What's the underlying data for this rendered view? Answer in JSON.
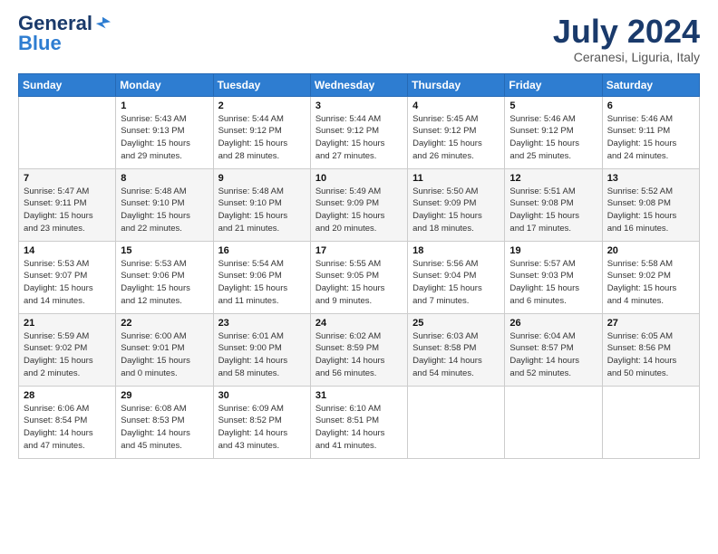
{
  "logo": {
    "general": "General",
    "blue": "Blue"
  },
  "title": "July 2024",
  "location": "Ceranesi, Liguria, Italy",
  "weekdays": [
    "Sunday",
    "Monday",
    "Tuesday",
    "Wednesday",
    "Thursday",
    "Friday",
    "Saturday"
  ],
  "weeks": [
    [
      {
        "day": "",
        "info": ""
      },
      {
        "day": "1",
        "info": "Sunrise: 5:43 AM\nSunset: 9:13 PM\nDaylight: 15 hours\nand 29 minutes."
      },
      {
        "day": "2",
        "info": "Sunrise: 5:44 AM\nSunset: 9:12 PM\nDaylight: 15 hours\nand 28 minutes."
      },
      {
        "day": "3",
        "info": "Sunrise: 5:44 AM\nSunset: 9:12 PM\nDaylight: 15 hours\nand 27 minutes."
      },
      {
        "day": "4",
        "info": "Sunrise: 5:45 AM\nSunset: 9:12 PM\nDaylight: 15 hours\nand 26 minutes."
      },
      {
        "day": "5",
        "info": "Sunrise: 5:46 AM\nSunset: 9:12 PM\nDaylight: 15 hours\nand 25 minutes."
      },
      {
        "day": "6",
        "info": "Sunrise: 5:46 AM\nSunset: 9:11 PM\nDaylight: 15 hours\nand 24 minutes."
      }
    ],
    [
      {
        "day": "7",
        "info": "Sunrise: 5:47 AM\nSunset: 9:11 PM\nDaylight: 15 hours\nand 23 minutes."
      },
      {
        "day": "8",
        "info": "Sunrise: 5:48 AM\nSunset: 9:10 PM\nDaylight: 15 hours\nand 22 minutes."
      },
      {
        "day": "9",
        "info": "Sunrise: 5:48 AM\nSunset: 9:10 PM\nDaylight: 15 hours\nand 21 minutes."
      },
      {
        "day": "10",
        "info": "Sunrise: 5:49 AM\nSunset: 9:09 PM\nDaylight: 15 hours\nand 20 minutes."
      },
      {
        "day": "11",
        "info": "Sunrise: 5:50 AM\nSunset: 9:09 PM\nDaylight: 15 hours\nand 18 minutes."
      },
      {
        "day": "12",
        "info": "Sunrise: 5:51 AM\nSunset: 9:08 PM\nDaylight: 15 hours\nand 17 minutes."
      },
      {
        "day": "13",
        "info": "Sunrise: 5:52 AM\nSunset: 9:08 PM\nDaylight: 15 hours\nand 16 minutes."
      }
    ],
    [
      {
        "day": "14",
        "info": "Sunrise: 5:53 AM\nSunset: 9:07 PM\nDaylight: 15 hours\nand 14 minutes."
      },
      {
        "day": "15",
        "info": "Sunrise: 5:53 AM\nSunset: 9:06 PM\nDaylight: 15 hours\nand 12 minutes."
      },
      {
        "day": "16",
        "info": "Sunrise: 5:54 AM\nSunset: 9:06 PM\nDaylight: 15 hours\nand 11 minutes."
      },
      {
        "day": "17",
        "info": "Sunrise: 5:55 AM\nSunset: 9:05 PM\nDaylight: 15 hours\nand 9 minutes."
      },
      {
        "day": "18",
        "info": "Sunrise: 5:56 AM\nSunset: 9:04 PM\nDaylight: 15 hours\nand 7 minutes."
      },
      {
        "day": "19",
        "info": "Sunrise: 5:57 AM\nSunset: 9:03 PM\nDaylight: 15 hours\nand 6 minutes."
      },
      {
        "day": "20",
        "info": "Sunrise: 5:58 AM\nSunset: 9:02 PM\nDaylight: 15 hours\nand 4 minutes."
      }
    ],
    [
      {
        "day": "21",
        "info": "Sunrise: 5:59 AM\nSunset: 9:02 PM\nDaylight: 15 hours\nand 2 minutes."
      },
      {
        "day": "22",
        "info": "Sunrise: 6:00 AM\nSunset: 9:01 PM\nDaylight: 15 hours\nand 0 minutes."
      },
      {
        "day": "23",
        "info": "Sunrise: 6:01 AM\nSunset: 9:00 PM\nDaylight: 14 hours\nand 58 minutes."
      },
      {
        "day": "24",
        "info": "Sunrise: 6:02 AM\nSunset: 8:59 PM\nDaylight: 14 hours\nand 56 minutes."
      },
      {
        "day": "25",
        "info": "Sunrise: 6:03 AM\nSunset: 8:58 PM\nDaylight: 14 hours\nand 54 minutes."
      },
      {
        "day": "26",
        "info": "Sunrise: 6:04 AM\nSunset: 8:57 PM\nDaylight: 14 hours\nand 52 minutes."
      },
      {
        "day": "27",
        "info": "Sunrise: 6:05 AM\nSunset: 8:56 PM\nDaylight: 14 hours\nand 50 minutes."
      }
    ],
    [
      {
        "day": "28",
        "info": "Sunrise: 6:06 AM\nSunset: 8:54 PM\nDaylight: 14 hours\nand 47 minutes."
      },
      {
        "day": "29",
        "info": "Sunrise: 6:08 AM\nSunset: 8:53 PM\nDaylight: 14 hours\nand 45 minutes."
      },
      {
        "day": "30",
        "info": "Sunrise: 6:09 AM\nSunset: 8:52 PM\nDaylight: 14 hours\nand 43 minutes."
      },
      {
        "day": "31",
        "info": "Sunrise: 6:10 AM\nSunset: 8:51 PM\nDaylight: 14 hours\nand 41 minutes."
      },
      {
        "day": "",
        "info": ""
      },
      {
        "day": "",
        "info": ""
      },
      {
        "day": "",
        "info": ""
      }
    ]
  ]
}
